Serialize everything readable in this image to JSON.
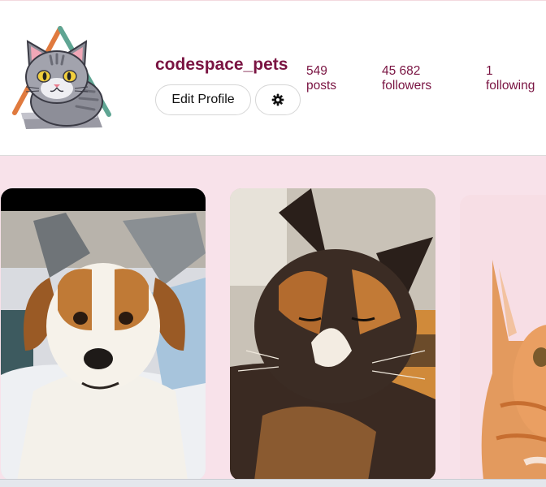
{
  "profile": {
    "username": "codespace_pets",
    "edit_button_label": "Edit Profile",
    "settings_icon": "gear-icon",
    "avatar_icon": "cartoon-cat-avatar"
  },
  "stats": {
    "posts": {
      "value": "549",
      "label": "posts"
    },
    "followers": {
      "value": "45 682",
      "label": "followers"
    },
    "following": {
      "value": "1",
      "label": "following"
    }
  },
  "gallery": {
    "items": [
      {
        "subject": "brown and white puppy"
      },
      {
        "subject": "tortoiseshell cat"
      },
      {
        "subject": "orange cat"
      }
    ]
  },
  "colors": {
    "accent": "#7a1442",
    "gallery_background": "#f8e2ea"
  }
}
